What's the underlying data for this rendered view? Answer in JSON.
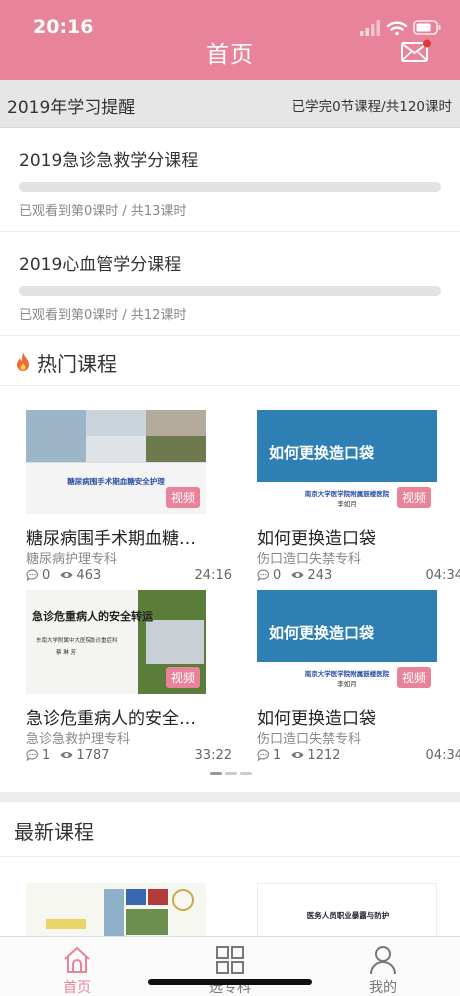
{
  "status": {
    "time": "20:16"
  },
  "header": {
    "title": "首页",
    "mail_icon": "mail-icon"
  },
  "reminder": {
    "title": "2019年学习提醒",
    "status": "已学完0节课程/共120课时"
  },
  "courses": [
    {
      "title": "2019急诊急救学分课程",
      "progress": 0,
      "info": "已观看到第0课时 / 共13课时"
    },
    {
      "title": "2019心血管学分课程",
      "progress": 0,
      "info": "已观看到第0课时 / 共12课时"
    }
  ],
  "hot": {
    "title": "热门课程",
    "icon": "fire-icon",
    "items": [
      {
        "title": "糖尿病围手术期血糖…",
        "subtitle": "糖尿病护理专科",
        "comments": "0",
        "views": "463",
        "duration": "24:16",
        "badge": "视频",
        "thumb_text": "糖尿病围手术期血糖安全护理"
      },
      {
        "title": "如何更换造口袋",
        "subtitle": "伤口造口失禁专科",
        "comments": "0",
        "views": "243",
        "duration": "04:34",
        "badge": "视频",
        "thumb_text": "如何更换造口袋",
        "thumb_sub": "南京大学医学院附属鼓楼医院",
        "thumb_name": "李如月"
      },
      {
        "title": "急诊危重病人的安全…",
        "subtitle": "急诊急救护理专科",
        "comments": "1",
        "views": "1787",
        "duration": "33:22",
        "badge": "视频",
        "thumb_text": "急诊危重病人的安全转运",
        "thumb_sub": "东南大学附属中大医院",
        "thumb_dept": "急诊重症科",
        "thumb_name": "蔡 琳 芳"
      },
      {
        "title": "如何更换造口袋",
        "subtitle": "伤口造口失禁专科",
        "comments": "1",
        "views": "1212",
        "duration": "04:34",
        "badge": "视频",
        "thumb_text": "如何更换造口袋",
        "thumb_sub": "南京大学医学院附属鼓楼医院",
        "thumb_name": "李如月"
      }
    ]
  },
  "latest": {
    "title": "最新课程",
    "item2_text": "医务人员职业暴露与防护"
  },
  "tabs": [
    {
      "label": "首页",
      "icon": "home-icon"
    },
    {
      "label": "选专科",
      "icon": "grid-icon"
    },
    {
      "label": "我的",
      "icon": "user-icon"
    }
  ],
  "colors": {
    "accent": "#e7849c",
    "thumb_blue": "#2e7fb3"
  }
}
